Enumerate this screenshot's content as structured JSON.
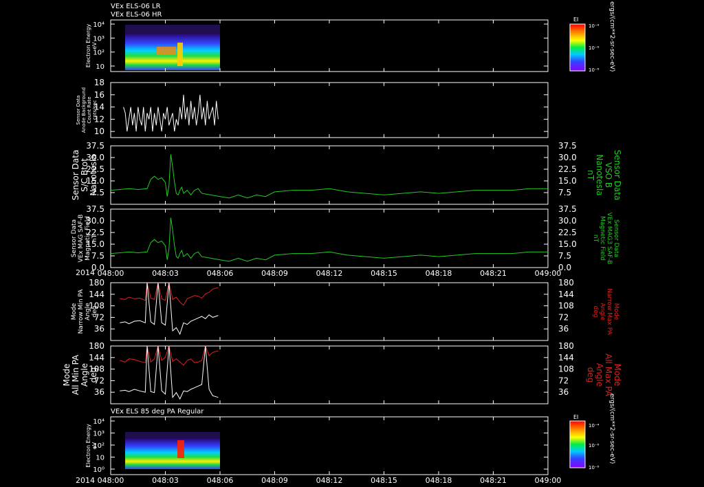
{
  "header": {
    "title_line1": "VEx ELS-06 LR",
    "title_line2": "VEx ELS-06 HR",
    "bottom_panel_title": "VEx ELS 85 deg PA Regular"
  },
  "time_axis": {
    "year": "2014",
    "ticks": [
      "048:00",
      "048:03",
      "048:06",
      "048:09",
      "048:12",
      "048:15",
      "048:18",
      "048:21",
      "049:00"
    ]
  },
  "colorbar": {
    "title": "EI",
    "tick_top": "10⁻⁴",
    "tick_mid": "10⁻⁶",
    "tick_bot": "10⁻⁸",
    "units": "ergs/(cm**2-sr-sec-eV)"
  },
  "colors": {
    "white": "#ffffff",
    "green": "#22cc22",
    "red": "#dd2222",
    "background": "#000000"
  },
  "chart_data": [
    {
      "type": "heatmap",
      "panel": "electron-energy-top",
      "ylabel": [
        "Electron Energy",
        "eV"
      ],
      "yticks": [
        "10",
        "10²",
        "10³",
        "10⁴"
      ],
      "data_time_range": [
        "048:00:40",
        "048:05:55"
      ]
    },
    {
      "type": "line",
      "panel": "background-count-rate",
      "ylabel": [
        "Sensor Data",
        "Anode Background",
        "Count Rate",
        "cnts/sec"
      ],
      "ylim": [
        9,
        18
      ],
      "yticks": [
        "10",
        "12",
        "14",
        "16",
        "18"
      ],
      "series": [
        {
          "color": "white",
          "x_minutes": [
            0.7,
            0.8,
            0.9,
            1.0,
            1.1,
            1.2,
            1.3,
            1.4,
            1.5,
            1.6,
            1.7,
            1.8,
            1.9,
            2.0,
            2.1,
            2.2,
            2.3,
            2.4,
            2.5,
            2.6,
            2.7,
            2.8,
            2.9,
            3.0,
            3.1,
            3.2,
            3.3,
            3.4,
            3.5,
            3.6,
            3.7,
            3.8,
            3.9,
            4.0,
            4.1,
            4.2,
            4.3,
            4.4,
            4.5,
            4.6,
            4.7,
            4.8,
            4.9,
            5.0,
            5.1,
            5.2,
            5.3,
            5.4,
            5.5,
            5.6,
            5.7,
            5.8,
            5.9
          ],
          "values": [
            14,
            13,
            10,
            12,
            14,
            11,
            13,
            10,
            14,
            12,
            11,
            14,
            10,
            13,
            12,
            14,
            10,
            13,
            11,
            14,
            12,
            10,
            13,
            12,
            14,
            11,
            12,
            13,
            10,
            12,
            11,
            14,
            12,
            16,
            12,
            14,
            11,
            15,
            12,
            14,
            11,
            13,
            16,
            12,
            14,
            11,
            15,
            12,
            13,
            14,
            11,
            15,
            12
          ]
        }
      ]
    },
    {
      "type": "line",
      "panel": "bmag-1",
      "ylabel": [
        "Sensor Data",
        "S/C Btot",
        "Nanotesla"
      ],
      "ylabel_right": [
        "Sensor Data",
        "VSO B",
        "Nanotesla",
        "nT"
      ],
      "ylim": [
        0,
        37.5
      ],
      "yticks": [
        "7.5",
        "15.0",
        "22.5",
        "30.0",
        "37.5"
      ],
      "series": [
        {
          "color": "green",
          "x_minutes": [
            0,
            0.5,
            1.0,
            1.5,
            2.0,
            2.2,
            2.4,
            2.6,
            2.8,
            3.0,
            3.1,
            3.2,
            3.3,
            3.4,
            3.5,
            3.6,
            3.7,
            3.8,
            3.9,
            4.0,
            4.2,
            4.4,
            4.6,
            4.8,
            5.0,
            5.5,
            6.0,
            6.5,
            7.0,
            7.5,
            8.0,
            8.5,
            9.0,
            10,
            11,
            12,
            13,
            14,
            15,
            16,
            17,
            18,
            19,
            20,
            21,
            22,
            23,
            24
          ],
          "values": [
            9,
            9.5,
            10,
            9.5,
            10,
            16,
            18,
            16,
            17,
            14,
            5,
            12,
            32,
            24,
            14,
            7,
            6,
            9,
            11,
            7,
            9,
            6,
            9,
            10,
            7,
            6,
            5,
            4,
            6,
            4,
            6,
            5,
            8,
            9,
            9,
            10,
            8,
            7,
            6,
            7,
            8,
            7,
            8,
            9,
            9,
            9,
            10,
            10
          ]
        }
      ]
    },
    {
      "type": "line",
      "panel": "bmag-2",
      "ylabel": [
        "Sensor Data",
        "VEx MAG SAF-B",
        "Magnetic Field",
        "nT"
      ],
      "ylabel_right": [
        "Sensor Data",
        "VEx MAG3 SAF-B",
        "Magnetic Field",
        "nT"
      ],
      "ylim": [
        0,
        37.5
      ],
      "yticks": [
        "0.0",
        "7.5",
        "15.0",
        "22.5",
        "30.0",
        "37.5"
      ],
      "series": [
        {
          "color": "green",
          "x_minutes": [
            0,
            0.5,
            1.0,
            1.5,
            2.0,
            2.2,
            2.4,
            2.6,
            2.8,
            3.0,
            3.1,
            3.2,
            3.3,
            3.4,
            3.5,
            3.6,
            3.7,
            3.8,
            3.9,
            4.0,
            4.2,
            4.4,
            4.6,
            4.8,
            5.0,
            5.5,
            6.0,
            6.5,
            7.0,
            7.5,
            8.0,
            8.5,
            9.0,
            10,
            11,
            12,
            13,
            14,
            15,
            16,
            17,
            18,
            19,
            20,
            21,
            22,
            23,
            24
          ],
          "values": [
            9,
            9.5,
            10,
            9.5,
            10,
            16,
            18,
            16,
            17,
            14,
            5,
            12,
            32,
            24,
            14,
            7,
            6,
            9,
            11,
            7,
            9,
            6,
            9,
            10,
            7,
            6,
            5,
            4,
            6,
            4,
            6,
            5,
            8,
            9,
            9,
            10,
            8,
            7,
            6,
            7,
            8,
            7,
            8,
            9,
            9,
            9,
            10,
            10
          ]
        }
      ]
    },
    {
      "type": "line",
      "panel": "pitch-angle-narrow",
      "ylabel": [
        "Mode",
        "Narrow Min PA",
        "Angle",
        "deg"
      ],
      "ylabel_right": [
        "Mode",
        "Narrow Max PA",
        "Angle",
        "deg"
      ],
      "ylim": [
        0,
        180
      ],
      "yticks": [
        "36",
        "72",
        "108",
        "144",
        "180"
      ],
      "series": [
        {
          "color": "red",
          "x_minutes": [
            0.5,
            0.8,
            1.0,
            1.3,
            1.6,
            1.9,
            2.0,
            2.2,
            2.4,
            2.6,
            2.8,
            3.0,
            3.2,
            3.4,
            3.6,
            3.8,
            4.0,
            4.2,
            4.4,
            4.6,
            4.8,
            5.0,
            5.2,
            5.4,
            5.6,
            5.9
          ],
          "values": [
            130,
            128,
            135,
            130,
            132,
            125,
            180,
            132,
            128,
            180,
            130,
            125,
            180,
            128,
            135,
            120,
            110,
            130,
            135,
            140,
            138,
            132,
            145,
            150,
            160,
            165
          ]
        },
        {
          "color": "white",
          "x_minutes": [
            0.5,
            0.8,
            1.0,
            1.3,
            1.6,
            1.9,
            2.0,
            2.2,
            2.4,
            2.6,
            2.8,
            3.0,
            3.2,
            3.4,
            3.6,
            3.8,
            4.0,
            4.2,
            4.4,
            4.6,
            4.8,
            5.0,
            5.2,
            5.4,
            5.6,
            5.9
          ],
          "values": [
            55,
            58,
            52,
            60,
            62,
            55,
            180,
            58,
            50,
            180,
            55,
            48,
            180,
            30,
            40,
            20,
            55,
            50,
            60,
            65,
            70,
            75,
            68,
            80,
            72,
            78
          ]
        }
      ]
    },
    {
      "type": "line",
      "panel": "pitch-angle-all",
      "ylabel": [
        "Mode",
        "All Min PA",
        "Angle",
        "deg"
      ],
      "ylabel_right": [
        "Mode",
        "All Max PA",
        "Angle",
        "deg"
      ],
      "ylim": [
        0,
        180
      ],
      "yticks": [
        "36",
        "72",
        "108",
        "144",
        "180"
      ],
      "series": [
        {
          "color": "red",
          "x_minutes": [
            0.5,
            0.8,
            1.0,
            1.3,
            1.6,
            1.9,
            2.0,
            2.2,
            2.4,
            2.6,
            2.8,
            3.0,
            3.2,
            3.4,
            3.6,
            3.8,
            4.0,
            4.2,
            4.4,
            4.6,
            4.8,
            5.0,
            5.2,
            5.4,
            5.6,
            5.9
          ],
          "values": [
            135,
            130,
            140,
            138,
            132,
            128,
            180,
            130,
            140,
            180,
            135,
            145,
            180,
            132,
            140,
            130,
            120,
            135,
            140,
            128,
            130,
            135,
            180,
            150,
            160,
            165
          ]
        },
        {
          "color": "white",
          "x_minutes": [
            0.5,
            0.8,
            1.0,
            1.3,
            1.6,
            1.9,
            2.0,
            2.2,
            2.4,
            2.6,
            2.8,
            3.0,
            3.2,
            3.4,
            3.6,
            3.8,
            4.0,
            4.2,
            4.4,
            4.6,
            4.8,
            5.0,
            5.2,
            5.4,
            5.6,
            5.9
          ],
          "values": [
            40,
            42,
            38,
            45,
            40,
            36,
            180,
            38,
            35,
            180,
            40,
            30,
            180,
            20,
            35,
            15,
            40,
            38,
            45,
            50,
            55,
            60,
            180,
            45,
            25,
            20
          ]
        }
      ]
    },
    {
      "type": "heatmap",
      "panel": "electron-energy-bottom",
      "ylabel": [
        "Electron Energy",
        "eV"
      ],
      "yticks": [
        "10⁰",
        "10",
        "10²",
        "10³",
        "10⁴"
      ],
      "data_time_range": [
        "048:00:40",
        "048:05:55"
      ]
    }
  ]
}
